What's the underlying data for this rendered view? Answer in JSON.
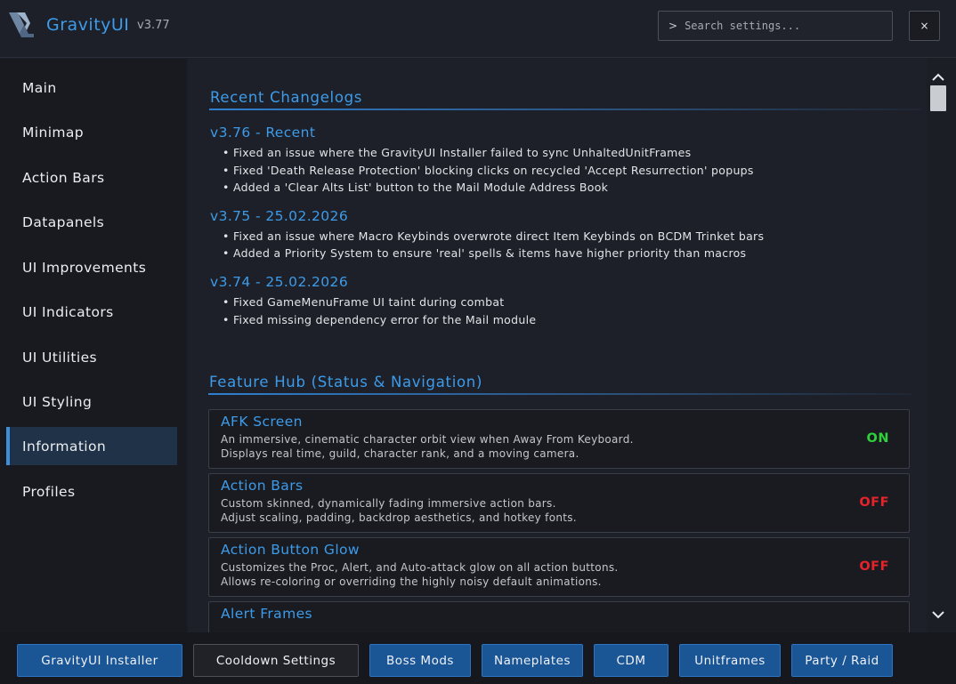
{
  "header": {
    "title": "GravityUI",
    "version": "v3.77",
    "search_prompt": ">",
    "search_placeholder": "Search settings...",
    "close_label": "×"
  },
  "sidebar": {
    "items": [
      {
        "label": "Main"
      },
      {
        "label": "Minimap"
      },
      {
        "label": "Action Bars"
      },
      {
        "label": "Datapanels"
      },
      {
        "label": "UI Improvements"
      },
      {
        "label": "UI Indicators"
      },
      {
        "label": "UI Utilities"
      },
      {
        "label": "UI Styling"
      },
      {
        "label": "Information",
        "active": true
      },
      {
        "label": "Profiles"
      }
    ]
  },
  "changelogs": {
    "title": "Recent Changelogs",
    "versions": [
      {
        "heading": "v3.76 - Recent",
        "items": [
          "• Fixed an issue where the GravityUI Installer failed to sync UnhaltedUnitFrames",
          "• Fixed 'Death Release Protection' blocking clicks on recycled 'Accept Resurrection' popups",
          "• Added a 'Clear Alts List' button to the Mail Module Address Book"
        ]
      },
      {
        "heading": "v3.75 - 25.02.2026",
        "items": [
          "• Fixed an issue where Macro Keybinds overwrote direct Item Keybinds on BCDM Trinket bars",
          "• Added a Priority System to ensure 'real' spells & items have higher priority than macros"
        ]
      },
      {
        "heading": "v3.74 - 25.02.2026",
        "items": [
          "• Fixed GameMenuFrame UI taint during combat",
          "• Fixed missing dependency error for the Mail module"
        ]
      }
    ]
  },
  "feature_hub": {
    "title": "Feature Hub (Status & Navigation)",
    "features": [
      {
        "name": "AFK Screen",
        "desc1": "An immersive, cinematic character orbit view when Away From Keyboard.",
        "desc2": "Displays real time, guild, character rank, and a moving camera.",
        "status": "ON"
      },
      {
        "name": "Action Bars",
        "desc1": "Custom skinned, dynamically fading immersive action bars.",
        "desc2": "Adjust scaling, padding, backdrop aesthetics, and hotkey fonts.",
        "status": "OFF"
      },
      {
        "name": "Action Button Glow",
        "desc1": "Customizes the Proc, Alert, and Auto-attack glow on all action buttons.",
        "desc2": "Allows re-coloring or overriding the highly noisy default animations.",
        "status": "OFF"
      },
      {
        "name": "Alert Frames",
        "desc1": "",
        "desc2": "",
        "status": ""
      }
    ]
  },
  "footer": {
    "buttons": [
      {
        "label": "GravityUI Installer"
      },
      {
        "label": "Cooldown Settings"
      },
      {
        "label": "Boss Mods"
      },
      {
        "label": "Nameplates"
      },
      {
        "label": "CDM"
      },
      {
        "label": "Unitframes"
      },
      {
        "label": "Party / Raid"
      }
    ]
  },
  "colors": {
    "accent": "#3d9be9",
    "status_on": "#2ed13a",
    "status_off": "#e5232b",
    "button_blue": "#1a5596"
  }
}
